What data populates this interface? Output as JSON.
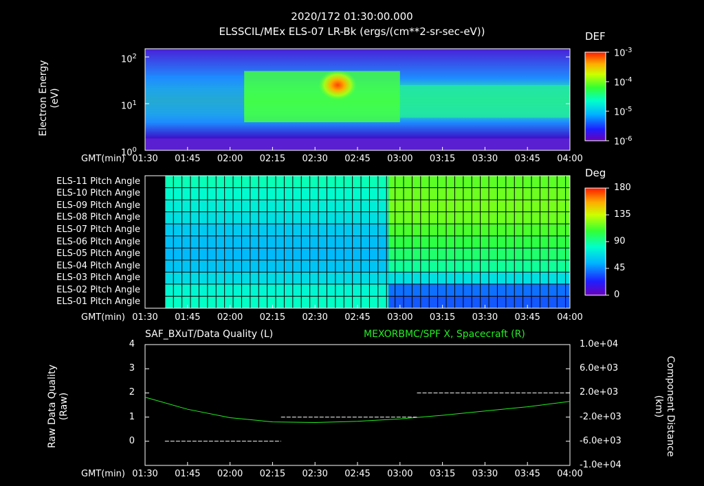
{
  "header": {
    "date_time": "2020/172 01:30:00.000",
    "product": "ELSSCIL/MEx ELS-07 LR-Bk  (ergs/(cm**2-sr-sec-eV))"
  },
  "panel1": {
    "ylabel_line1": "Electron Energy",
    "ylabel_line2": "(eV)",
    "y_ticks": [
      {
        "v": 100,
        "mant": "10",
        "exp": "2"
      },
      {
        "v": 10,
        "mant": "10",
        "exp": "1"
      },
      {
        "v": 1,
        "mant": "10",
        "exp": "0"
      }
    ],
    "colorbar": {
      "label": "DEF",
      "ticks": [
        {
          "v": -3,
          "mant": "10",
          "exp": "-3"
        },
        {
          "v": -4,
          "mant": "10",
          "exp": "-4"
        },
        {
          "v": -5,
          "mant": "10",
          "exp": "-5"
        },
        {
          "v": -6,
          "mant": "10",
          "exp": "-6"
        }
      ]
    }
  },
  "panel2": {
    "row_labels": [
      "ELS-11 Pitch Angle",
      "ELS-10 Pitch Angle",
      "ELS-09 Pitch Angle",
      "ELS-08 Pitch Angle",
      "ELS-07 Pitch Angle",
      "ELS-06 Pitch Angle",
      "ELS-05 Pitch Angle",
      "ELS-04 Pitch Angle",
      "ELS-03 Pitch Angle",
      "ELS-02 Pitch Angle",
      "ELS-01 Pitch Angle"
    ],
    "colorbar": {
      "label": "Deg",
      "ticks": [
        "180",
        "135",
        "90",
        "45",
        "0"
      ]
    }
  },
  "panel3": {
    "left_title": "SAF_BXuT/Data Quality (L)",
    "right_title": "MEXORBMC/SPF X, Spacecraft (R)",
    "ylabel_left_line1": "Raw Data Quality",
    "ylabel_left_line2": "(Raw)",
    "ylabel_right_line1": "Component Distance",
    "ylabel_right_line2": "(km)",
    "left_ticks": [
      "4",
      "3",
      "2",
      "1",
      "0"
    ],
    "right_ticks": [
      "1.0e+04",
      "6.0e+03",
      "2.0e+03",
      "-2.0e+03",
      "-6.0e+03",
      "-1.0e+04"
    ]
  },
  "time_axis": {
    "label": "GMT(min)",
    "ticks": [
      "01:30",
      "01:45",
      "02:00",
      "02:15",
      "02:30",
      "02:45",
      "03:00",
      "03:15",
      "03:30",
      "03:45",
      "04:00"
    ]
  },
  "colors": {
    "background": "#000000",
    "axes": "#ffffff",
    "orbit_line": "#22ee22"
  },
  "chart_data": [
    {
      "type": "heatmap",
      "title": "ELSSCIL/MEx ELS-07 LR-Bk  (ergs/(cm**2-sr-sec-eV))",
      "ylabel": "Electron Energy (eV)",
      "y_scale": "log",
      "ylim": [
        1,
        150
      ],
      "xlim": [
        "01:30",
        "04:00"
      ],
      "colorbar": {
        "label": "DEF",
        "scale": "log",
        "range": [
          1e-06,
          0.001
        ]
      },
      "description_points": [
        {
          "time": "01:30",
          "peak_energy_eV": 12,
          "level": 3e-05
        },
        {
          "time": "02:05",
          "peak_energy_eV": 15,
          "level": 0.0001
        },
        {
          "time": "02:40",
          "peak_energy_eV": 25,
          "level": 0.0005
        },
        {
          "time": "03:00",
          "peak_energy_eV": 12,
          "level": 4e-05
        },
        {
          "time": "04:00",
          "peak_energy_eV": 12,
          "level": 4e-05
        }
      ]
    },
    {
      "type": "heatmap",
      "ylabel": "Pitch Angle",
      "xlim": [
        "01:30",
        "04:00"
      ],
      "colorbar": {
        "label": "Deg",
        "range": [
          0,
          180
        ]
      },
      "series": [
        {
          "name": "ELS-11 Pitch Angle",
          "before_0255": 85,
          "after_0255": 115
        },
        {
          "name": "ELS-10 Pitch Angle",
          "before_0255": 80,
          "after_0255": 118
        },
        {
          "name": "ELS-09 Pitch Angle",
          "before_0255": 75,
          "after_0255": 120
        },
        {
          "name": "ELS-08 Pitch Angle",
          "before_0255": 70,
          "after_0255": 118
        },
        {
          "name": "ELS-07 Pitch Angle",
          "before_0255": 62,
          "after_0255": 112
        },
        {
          "name": "ELS-06 Pitch Angle",
          "before_0255": 58,
          "after_0255": 105
        },
        {
          "name": "ELS-05 Pitch Angle",
          "before_0255": 56,
          "after_0255": 98
        },
        {
          "name": "ELS-04 Pitch Angle",
          "before_0255": 60,
          "after_0255": 90
        },
        {
          "name": "ELS-03 Pitch Angle",
          "before_0255": 68,
          "after_0255": 70
        },
        {
          "name": "ELS-02 Pitch Angle",
          "before_0255": 78,
          "after_0255": 40
        },
        {
          "name": "ELS-01 Pitch Angle",
          "before_0255": 82,
          "after_0255": 35
        }
      ]
    },
    {
      "type": "line",
      "xlim": [
        "01:30",
        "04:00"
      ],
      "left_axis": {
        "label": "Raw Data Quality (Raw)",
        "ylim": [
          -1,
          4
        ]
      },
      "right_axis": {
        "label": "Component Distance (km)",
        "ylim": [
          -10000,
          10000
        ]
      },
      "series": [
        {
          "name": "SAF_BXuT/Data Quality (L)",
          "axis": "left",
          "segments": [
            {
              "x": [
                "01:37",
                "02:18"
              ],
              "y": 0
            },
            {
              "x": [
                "02:18",
                "03:06"
              ],
              "y": 1
            },
            {
              "x": [
                "03:06",
                "04:00"
              ],
              "y": 2
            }
          ]
        },
        {
          "name": "MEXORBMC/SPF X, Spacecraft (R)",
          "axis": "right",
          "x": [
            "01:30",
            "01:45",
            "02:00",
            "02:15",
            "02:30",
            "02:45",
            "03:00",
            "03:15",
            "03:30",
            "03:45",
            "04:00"
          ],
          "y": [
            1300,
            -700,
            -2100,
            -2800,
            -2900,
            -2700,
            -2300,
            -1700,
            -1000,
            -300,
            600
          ]
        }
      ]
    }
  ]
}
